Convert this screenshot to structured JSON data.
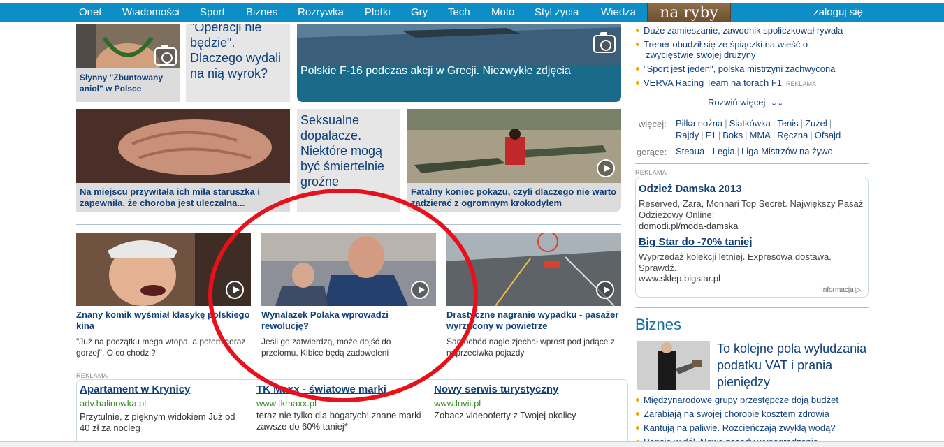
{
  "nav": {
    "items": [
      "Onet",
      "Wiadomości",
      "Sport",
      "Biznes",
      "Rozrywka",
      "Plotki",
      "Gry",
      "Tech",
      "Moto",
      "Styl życia",
      "Wiedza"
    ],
    "logo": "na ryby",
    "login": "zaloguj się"
  },
  "tiles": {
    "model_caption": "Słynny \"Zbuntowany anioł\" w Polsce",
    "verdict_text": "\"Operacji nie będzie\". Dlaczego wydali na nią wyrok?",
    "f16_caption": "Polskie F-16 podczas akcji w Grecji. Niezwykłe zdjęcia",
    "hands_caption": "Na miejscu przywitała ich miła staruszka i zapewniła, że choroba jest uleczalna...",
    "dopalacze_text": "Seksualne dopalacze. Niektóre mogą być śmiertelnie groźne",
    "croc_caption": "Fatalny koniec pokazu, czyli dlaczego nie warto zadzierać z ogromnym krokodylem"
  },
  "videos": [
    {
      "title": "Znany komik wyśmiał klasykę polskiego kina",
      "desc": "\"Już na początku mega wtopa, a potem coraz gorzej\". O co chodzi?"
    },
    {
      "title": "Wynalazek Polaka wprowadzi rewolucję?",
      "desc": "Jeśli go zatwierdzą, może dojść do przełomu. Kibice będą zadowoleni"
    },
    {
      "title": "Drastyczne nagranie wypadku - pasażer wyrzucony w powietrze",
      "desc": "Samochód nagle zjechał wprost pod jadące z naprzeciwka pojazdy"
    }
  ],
  "ads_bottom": {
    "label": "REKLAMA",
    "items": [
      {
        "title": "Apartament w Krynicy",
        "url": "adv.halinowka.pl",
        "desc": "Przytulnie, z pięknym widokiem Już od 40 zł za nocleg"
      },
      {
        "title": "TK Maxx - światowe marki",
        "url": "www.tkmaxx.pl",
        "desc": "teraz nie tylko dla bogatych! znane marki zawsze do 60% taniej*"
      },
      {
        "title": "Nowy serwis turystyczny",
        "url": "www.lovii.pl",
        "desc": "Zobacz videooferty z Twojej okolicy"
      }
    ]
  },
  "sport_list": [
    {
      "text": "Duże zamieszanie, zawodnik spoliczkował rywala",
      "tag": ""
    },
    {
      "text": "Trener obudził się ze śpiączki na wieść o",
      "tag": ""
    },
    {
      "text": "\"Sport jest jeden\", polska mistrzyni zachwycona",
      "tag": ""
    },
    {
      "text": "VERVA Racing Team na torach F1",
      "tag": "REKLAMA"
    }
  ],
  "sport_list_cont": "zwycięstwie swojej drużyny",
  "expand": "Rozwiń więcej",
  "more": {
    "label": "więcej:",
    "row1": [
      "Piłka nożna",
      "Siatkówka",
      "Tenis",
      "Żużel"
    ],
    "row2": [
      "Rajdy",
      "F1",
      "Boks",
      "MMA",
      "Ręczna",
      "Ofsajd"
    ]
  },
  "hot": {
    "label": "gorące:",
    "items": [
      "Steaua - Legia",
      "Liga Mistrzów na żywo"
    ]
  },
  "ads_right": {
    "label": "REKLAMA",
    "items": [
      {
        "title": "Odzież Damska 2013",
        "desc": "Reserved, Zara, Monnari Top Secret. Największy Pasaż Odzieżowy Online!",
        "url": "domodi.pl/moda-damska"
      },
      {
        "title": "Big Star do -70% taniej",
        "desc": "Wyprzedaż kolekcji letniej. Expresowa dostawa. Sprawdź.",
        "url": "www.sklep.bigstar.pl"
      }
    ],
    "info": "Informacja"
  },
  "biznes": {
    "section": "Biznes",
    "headline": "To kolejne pola wyłudzania podatku VAT i prania pieniędzy",
    "list": [
      "Międzynarodowe grupy przestępcze doją budżet",
      "Zarabiają na swojej chorobie kosztem zdrowia",
      "Kantują na paliwie. Rozcieńczają zwykłą wodą?",
      "Pensje w dół. Nowe zasady wynagradzania"
    ]
  }
}
